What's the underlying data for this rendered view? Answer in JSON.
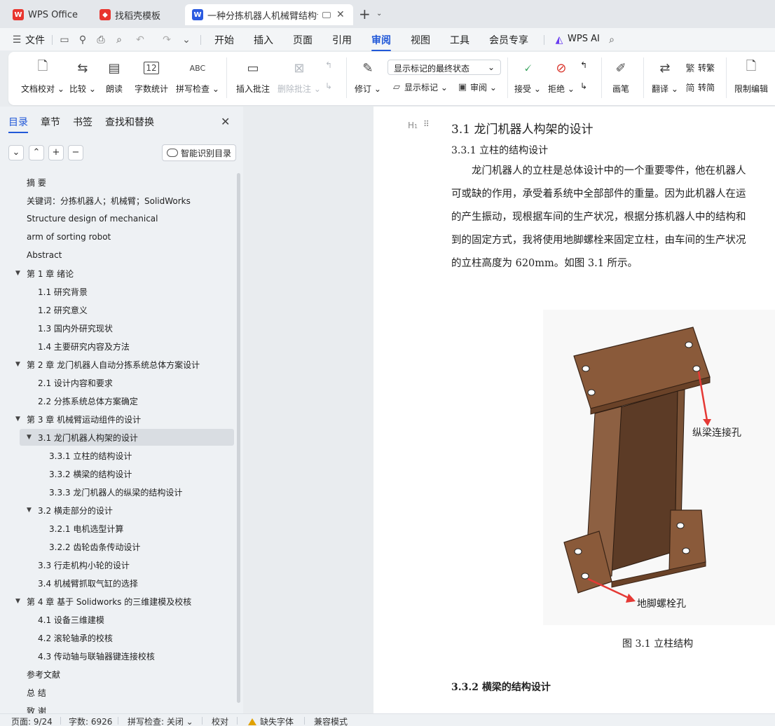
{
  "tabs": [
    {
      "label": "WPS Office",
      "icon": "wps-logo-icon",
      "color": "#e8352e"
    },
    {
      "label": "找稻壳模板",
      "icon": "docer-icon",
      "color": "#e8352e"
    },
    {
      "label": "一种分拣机器人机械臂结构设计",
      "icon": "word-doc-icon",
      "color": "#2b5be0"
    }
  ],
  "menu": {
    "file": "文件",
    "items": [
      "开始",
      "插入",
      "页面",
      "引用",
      "审阅",
      "视图",
      "工具",
      "会员专享"
    ],
    "active": "审阅",
    "ai": "WPS AI"
  },
  "ribbon": {
    "doc_check": "文档校对",
    "compare": "比较",
    "read_aloud": "朗读",
    "word_count": "字数统计",
    "word_count_icon_text": "12",
    "spell_check": "拼写检查",
    "spell_icon_text": "ABC",
    "insert_comment": "插入批注",
    "delete_comment": "删除批注",
    "track": "修订",
    "markup_dropdown": "显示标记的最终状态",
    "show_markup": "显示标记",
    "review": "审阅",
    "accept": "接受",
    "reject": "拒绝",
    "ink": "画笔",
    "translate": "翻译",
    "to_traditional": "转繁",
    "to_simplified": "转简",
    "restrict": "限制编辑"
  },
  "sidebar": {
    "tabs": [
      "目录",
      "章节",
      "书签",
      "查找和替换"
    ],
    "smart_toc": "智能识别目录",
    "toc": [
      {
        "text": "摘  要",
        "level": 0,
        "caret": ""
      },
      {
        "text": "关键词：分拣机器人；机械臂；SolidWorks",
        "level": 0,
        "caret": ""
      },
      {
        "text": "Structure design of mechanical",
        "level": 0,
        "caret": ""
      },
      {
        "text": "arm of sorting robot",
        "level": 0,
        "caret": ""
      },
      {
        "text": "Abstract",
        "level": 0,
        "caret": ""
      },
      {
        "text": "第 1 章  绪论",
        "level": 0,
        "caret": "▼"
      },
      {
        "text": "1.1  研究背景",
        "level": 1,
        "caret": ""
      },
      {
        "text": "1.2  研究意义",
        "level": 1,
        "caret": ""
      },
      {
        "text": "1.3  国内外研究现状",
        "level": 1,
        "caret": ""
      },
      {
        "text": "1.4  主要研究内容及方法",
        "level": 1,
        "caret": ""
      },
      {
        "text": "第 2 章  龙门机器人自动分拣系统总体方案设计",
        "level": 0,
        "caret": "▼"
      },
      {
        "text": "2.1 设计内容和要求",
        "level": 1,
        "caret": ""
      },
      {
        "text": "2.2 分拣系统总体方案确定",
        "level": 1,
        "caret": ""
      },
      {
        "text": "第 3 章  机械臂运动组件的设计",
        "level": 0,
        "caret": "▼"
      },
      {
        "text": "3.1 龙门机器人构架的设计",
        "level": 1,
        "caret": "▼",
        "selected": true
      },
      {
        "text": "3.3.1 立柱的结构设计",
        "level": 2,
        "caret": ""
      },
      {
        "text": "3.3.2 横梁的结构设计",
        "level": 2,
        "caret": ""
      },
      {
        "text": "3.3.3 龙门机器人的纵梁的结构设计",
        "level": 2,
        "caret": ""
      },
      {
        "text": "3.2  横走部分的设计",
        "level": 1,
        "caret": "▼"
      },
      {
        "text": "3.2.1 电机选型计算",
        "level": 2,
        "caret": ""
      },
      {
        "text": "3.2.2 齿轮齿条传动设计",
        "level": 2,
        "caret": ""
      },
      {
        "text": "3.3  行走机构小轮的设计",
        "level": 1,
        "caret": ""
      },
      {
        "text": "3.4  机械臂抓取气缸的选择",
        "level": 1,
        "caret": ""
      },
      {
        "text": "第 4 章  基于 Solidworks 的三维建模及校核",
        "level": 0,
        "caret": "▼"
      },
      {
        "text": "4.1  设备三维建模",
        "level": 1,
        "caret": ""
      },
      {
        "text": "4.2  滚轮轴承的校核",
        "level": 1,
        "caret": ""
      },
      {
        "text": "4.3 传动轴与联轴器键连接校核",
        "level": 1,
        "caret": ""
      },
      {
        "text": "参考文献",
        "level": 0,
        "caret": ""
      },
      {
        "text": "总  结",
        "level": 0,
        "caret": ""
      },
      {
        "text": "致  谢",
        "level": 0,
        "caret": ""
      }
    ]
  },
  "document": {
    "heading_marker": "H",
    "h2": "3.1 龙门机器人构架的设计",
    "h3": "3.3.1 立柱的结构设计",
    "paragraph_lines": [
      "　　龙门机器人的立柱是总体设计中的一个重要零件，他在机器人",
      "可或缺的作用，承受着系统中全部部件的重量。因为此机器人在运",
      "的产生振动，现根据车间的生产状况，根据分拣机器人中的结构和",
      "到的固定方式，我将使用地脚螺栓来固定立柱，由车间的生产状况",
      "的立柱高度为 620mm。如图 3.1 所示。"
    ],
    "figure_label_top": "纵梁连接孔",
    "figure_label_bottom": "地脚螺栓孔",
    "caption": "图 3.1 立柱结构",
    "next_heading": "3.3.2 横梁的结构设计"
  },
  "status": {
    "page": "页面: 9/24",
    "words": "字数: 6926",
    "spell": "拼写检查: 关闭",
    "proof": "校对",
    "missing_font": "缺失字体",
    "compat": "兼容模式"
  }
}
